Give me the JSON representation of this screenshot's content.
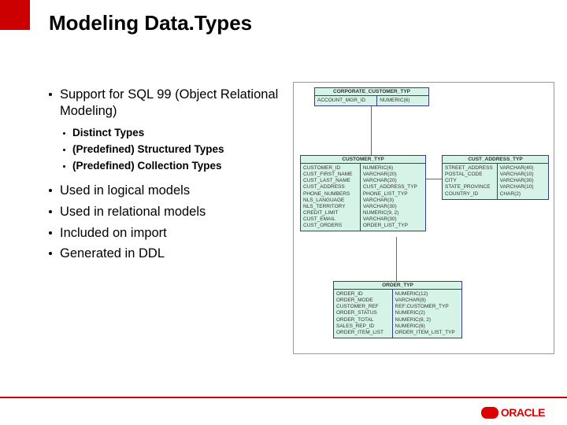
{
  "title": "Modeling Data.Types",
  "bullets": {
    "sql99": "Support for SQL 99 (Object Relational Modeling)",
    "sub": {
      "distinct": "Distinct Types",
      "structured": "(Predefined) Structured Types",
      "collection": "(Predefined) Collection Types"
    },
    "logical": "Used in logical models",
    "relational": "Used in relational models",
    "import": "Included on import",
    "ddl": "Generated in DDL"
  },
  "diagram": {
    "corporate": {
      "header": "CORPORATE_CUSTOMER_TYP",
      "left": "ACCOUNT_MGR_ID",
      "right": "NUMERIC(6)"
    },
    "customer": {
      "header": "CUSTOMER_TYP",
      "left": "CUSTOMER_ID\nCUST_FIRST_NAME\nCUST_LAST_NAME\nCUST_ADDRESS\nPHONE_NUMBERS\nNLS_LANGUAGE\nNLS_TERRITORY\nCREDIT_LIMIT\nCUST_EMAIL\nCUST_ORDERS",
      "right": "NUMERIC(6)\nVARCHAR(20)\nVARCHAR(20)\nCUST_ADDRESS_TYP\nPHONE_LIST_TYP\nVARCHAR(3)\nVARCHAR(30)\nNUMERIC(9, 2)\nVARCHAR(30)\nORDER_LIST_TYP"
    },
    "address": {
      "header": "CUST_ADDRESS_TYP",
      "left": "STREET_ADDRESS\nPOSTAL_CODE\nCITY\nSTATE_PROVINCE\nCOUNTRY_ID",
      "right": "VARCHAR(40)\nVARCHAR(10)\nVARCHAR(30)\nVARCHAR(10)\nCHAR(2)"
    },
    "order": {
      "header": "ORDER_TYP",
      "left": "ORDER_ID\nORDER_MODE\nCUSTOMER_REF\nORDER_STATUS\nORDER_TOTAL\nSALES_REP_ID\nORDER_ITEM_LIST",
      "right": "NUMERIC(12)\nVARCHAR(8)\nREF:CUSTOMER_TYP\nNUMERIC(2)\nNUMERIC(8, 2)\nNUMERIC(6)\nORDER_ITEM_LIST_TYP"
    }
  },
  "logo": "ORACLE"
}
